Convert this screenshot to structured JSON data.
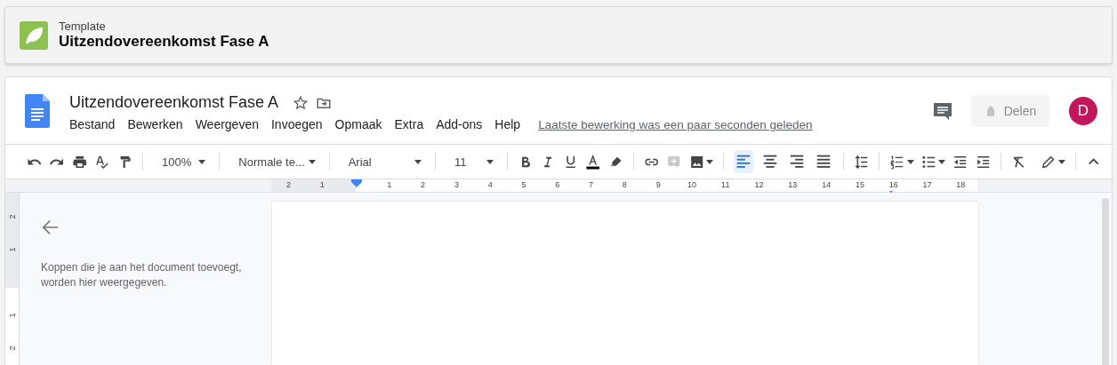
{
  "header": {
    "label": "Template",
    "title": "Uitzendovereenkomst Fase A"
  },
  "document": {
    "title": "Uitzendovereenkomst Fase A",
    "starred": false
  },
  "menu": [
    "Bestand",
    "Bewerken",
    "Weergeven",
    "Invoegen",
    "Opmaak",
    "Extra",
    "Add-ons",
    "Help"
  ],
  "last_edit": "Laatste bewerking was een paar seconden geleden",
  "share_button": {
    "label": "Delen",
    "disabled": true
  },
  "avatar": {
    "initial": "D",
    "color": "#c2185b"
  },
  "toolbar": {
    "zoom": "100%",
    "style": "Normale te...",
    "font": "Arial",
    "size": "11",
    "add_comment_disabled": true,
    "alignments": [
      {
        "selected": true
      },
      {
        "selected": false
      },
      {
        "selected": false
      },
      {
        "selected": false
      }
    ]
  },
  "ruler": {
    "left_labels": [
      "2",
      "1"
    ],
    "labels": [
      "1",
      "2",
      "3",
      "4",
      "5",
      "6",
      "7",
      "8",
      "9",
      "10",
      "11",
      "12",
      "13",
      "14",
      "15",
      "16",
      "17",
      "18"
    ]
  },
  "vertical_ruler": {
    "labels": [
      "2",
      "1",
      "1",
      "2"
    ]
  },
  "outline": {
    "empty_message": "Koppen die je aan het document toevoegt, worden hier weergegeven."
  }
}
